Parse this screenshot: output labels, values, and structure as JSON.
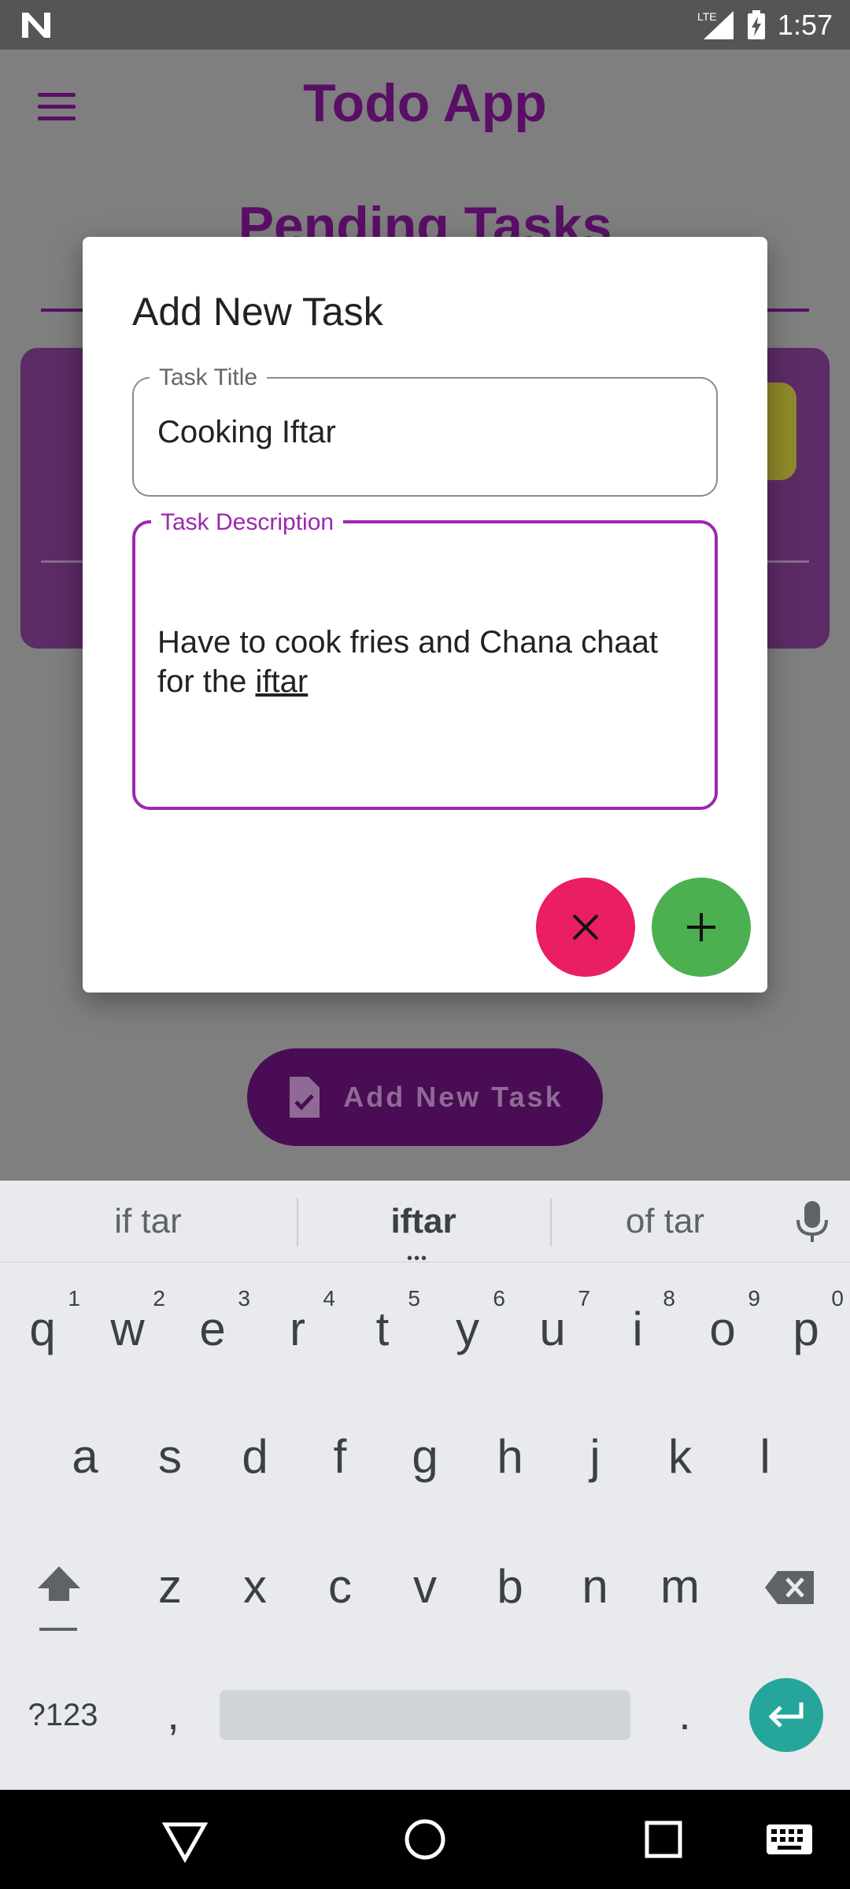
{
  "status_bar": {
    "time": "1:57",
    "network": "LTE",
    "icons": [
      "notification-n-icon",
      "lte-signal-icon",
      "battery-charging-icon"
    ]
  },
  "app": {
    "title": "Todo App",
    "section_title": "Pending Tasks",
    "add_task_button_label": "Add New Task",
    "icons": [
      "menu-icon",
      "task-file-icon"
    ]
  },
  "dialog": {
    "title": "Add New Task",
    "task_title": {
      "label": "Task Title",
      "value": "Cooking Iftar"
    },
    "task_description": {
      "label": "Task Description",
      "value_prefix": "Have to cook fries and Chana chaat for the ",
      "value_underlined": "iftar"
    },
    "cancel_icon": "close-icon",
    "add_icon": "plus-icon",
    "colors": {
      "cancel": "#e91e63",
      "add": "#4caf50",
      "focus": "#9c27b0"
    }
  },
  "keyboard": {
    "suggestions": [
      "if tar",
      "iftar",
      "of tar"
    ],
    "row1": [
      {
        "key": "q",
        "hint": "1"
      },
      {
        "key": "w",
        "hint": "2"
      },
      {
        "key": "e",
        "hint": "3"
      },
      {
        "key": "r",
        "hint": "4"
      },
      {
        "key": "t",
        "hint": "5"
      },
      {
        "key": "y",
        "hint": "6"
      },
      {
        "key": "u",
        "hint": "7"
      },
      {
        "key": "i",
        "hint": "8"
      },
      {
        "key": "o",
        "hint": "9"
      },
      {
        "key": "p",
        "hint": "0"
      }
    ],
    "row2": [
      "a",
      "s",
      "d",
      "f",
      "g",
      "h",
      "j",
      "k",
      "l"
    ],
    "row3": [
      "z",
      "x",
      "c",
      "v",
      "b",
      "n",
      "m"
    ],
    "symbols_label": "?123",
    "comma": ",",
    "period": "."
  }
}
